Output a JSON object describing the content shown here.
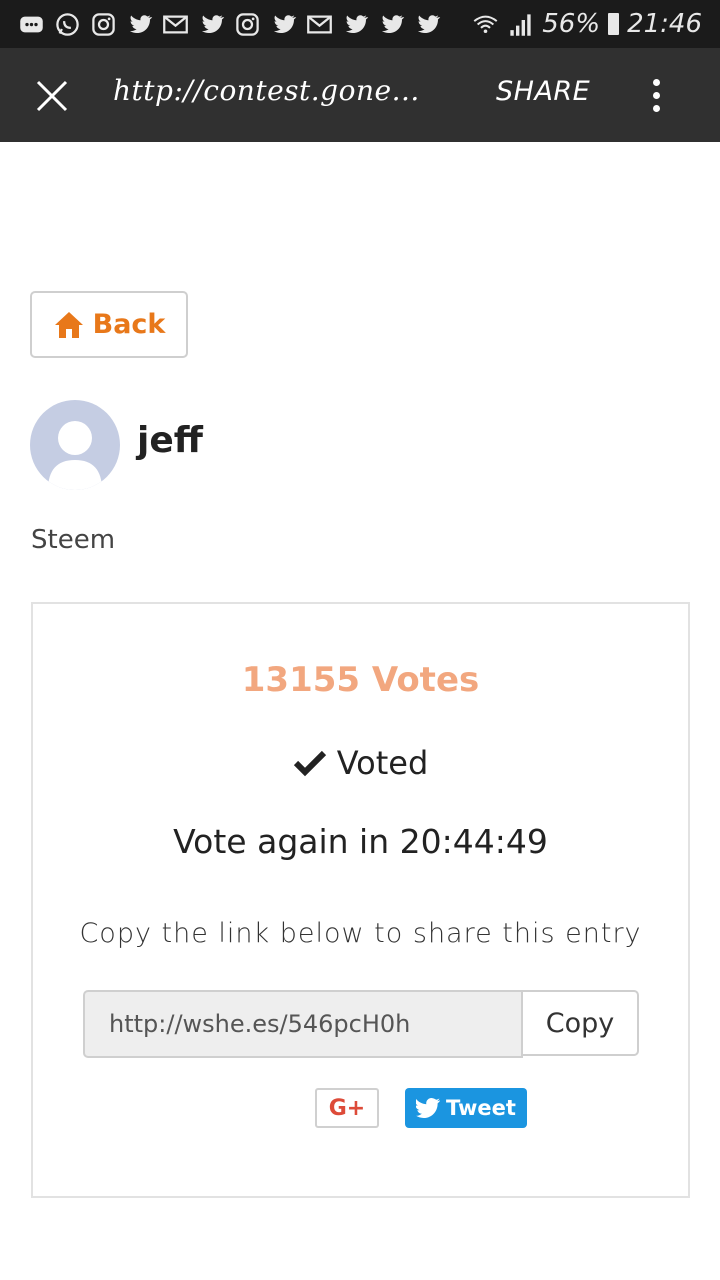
{
  "status_bar": {
    "icons": [
      "message-icon",
      "whatsapp-icon",
      "instagram-icon",
      "twitter-icon",
      "gmail-icon",
      "twitter-icon",
      "instagram-icon",
      "twitter-icon",
      "gmail-icon",
      "twitter-icon",
      "twitter-icon",
      "twitter-icon"
    ],
    "battery": "56%",
    "time": "21:46"
  },
  "browser_bar": {
    "url": "http://contest.gone...",
    "share_label": "SHARE"
  },
  "page": {
    "back_label": "Back",
    "username": "jeff",
    "entry_title": "Steem"
  },
  "card": {
    "votes": "13155 Votes",
    "voted_label": "Voted",
    "vote_again": "Vote again in 20:44:49",
    "copy_hint": "Copy the link below to share this entry",
    "share_link": "http://wshe.es/546pcH0h",
    "copy_label": "Copy",
    "gplus_label": "G+",
    "tweet_label": "Tweet"
  },
  "colors": {
    "accent_orange": "#e8781a",
    "votes_color": "#f2a77f",
    "twitter_blue": "#1b95e0",
    "gplus_red": "#dd4b39"
  }
}
